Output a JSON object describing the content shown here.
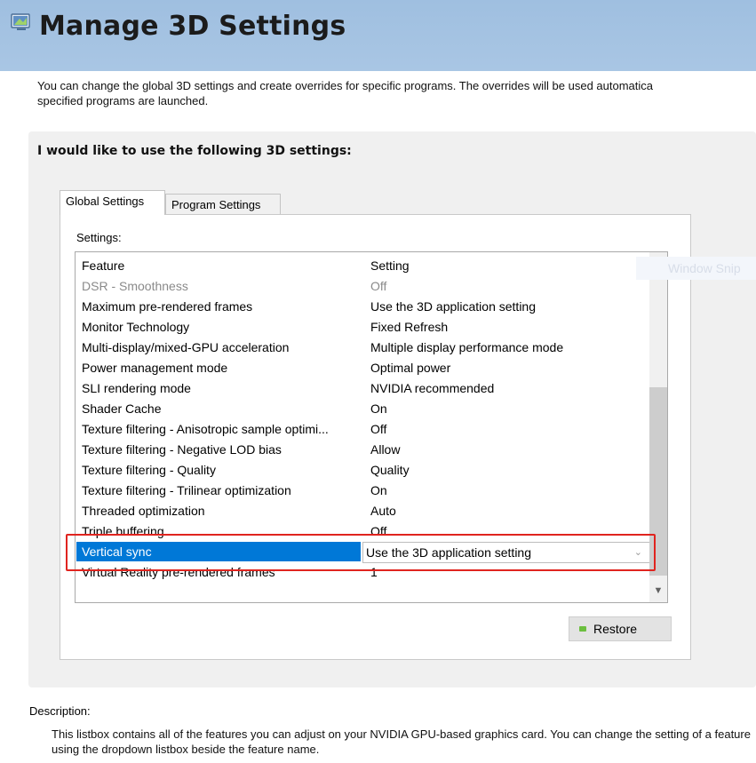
{
  "header": {
    "title": "Manage 3D Settings",
    "icon": "nvidia-settings-icon"
  },
  "intro": {
    "line1": "You can change the global 3D settings and create overrides for specific programs. The overrides will be used automatica",
    "line2": "specified programs are launched."
  },
  "panel": {
    "heading": "I would like to use the following 3D settings:"
  },
  "tabs": [
    {
      "label": "Global Settings",
      "active": true
    },
    {
      "label": "Program Settings",
      "active": false
    }
  ],
  "settings_label": "Settings:",
  "table": {
    "headers": {
      "feature": "Feature",
      "setting": "Setting"
    },
    "rows": [
      {
        "feature": "DSR - Smoothness",
        "setting": "Off"
      },
      {
        "feature": "Maximum pre-rendered frames",
        "setting": "Use the 3D application setting"
      },
      {
        "feature": "Monitor Technology",
        "setting": "Fixed Refresh"
      },
      {
        "feature": "Multi-display/mixed-GPU acceleration",
        "setting": "Multiple display performance mode"
      },
      {
        "feature": "Power management mode",
        "setting": "Optimal power"
      },
      {
        "feature": "SLI rendering mode",
        "setting": "NVIDIA recommended"
      },
      {
        "feature": "Shader Cache",
        "setting": "On"
      },
      {
        "feature": "Texture filtering - Anisotropic sample optimi...",
        "setting": "Off"
      },
      {
        "feature": "Texture filtering - Negative LOD bias",
        "setting": "Allow"
      },
      {
        "feature": "Texture filtering - Quality",
        "setting": "Quality"
      },
      {
        "feature": "Texture filtering - Trilinear optimization",
        "setting": "On"
      },
      {
        "feature": "Threaded optimization",
        "setting": "Auto"
      },
      {
        "feature": "Triple buffering",
        "setting": "Off"
      },
      {
        "feature": "Vertical sync",
        "setting": "Use the 3D application setting"
      },
      {
        "feature": "Virtual Reality pre-rendered frames",
        "setting": "1"
      }
    ],
    "selected_row": "Vertical sync"
  },
  "ghost_overlay": "Window Snip",
  "restore_button": "Restore",
  "description": {
    "label": "Description:",
    "text": "This listbox contains all of the features you can adjust on your NVIDIA GPU-based graphics card. You can change the setting of a feature using the dropdown listbox beside the feature name."
  },
  "colors": {
    "header_bg": "#a9c6e4",
    "selection": "#0078d7",
    "highlight_border": "#e0241f",
    "restore_icon": "#6cbf3f"
  }
}
